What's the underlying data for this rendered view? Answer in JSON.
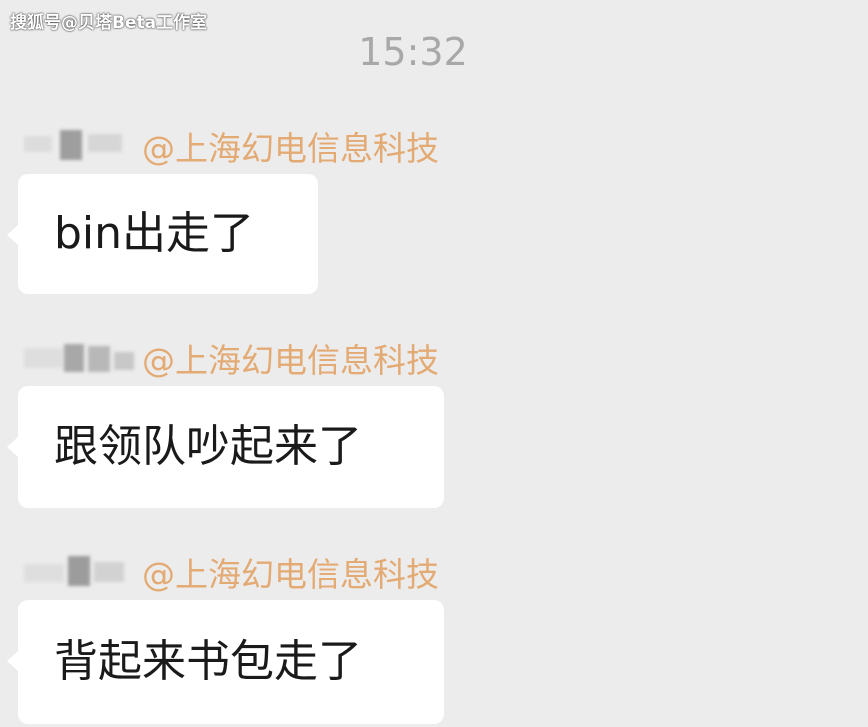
{
  "watermark": "搜狐号@贝塔Beta工作室",
  "timestamp": "15:32",
  "messages": [
    {
      "sender": "@上海幻电信息科技",
      "text": "bin出走了"
    },
    {
      "sender": "@上海幻电信息科技",
      "text": "跟领队吵起来了"
    },
    {
      "sender": "@上海幻电信息科技",
      "text": "背起来书包走了"
    }
  ],
  "colors": {
    "background": "#ececec",
    "bubble": "#ffffff",
    "sender_name": "#e3aa73",
    "timestamp": "#a8a8a8"
  }
}
